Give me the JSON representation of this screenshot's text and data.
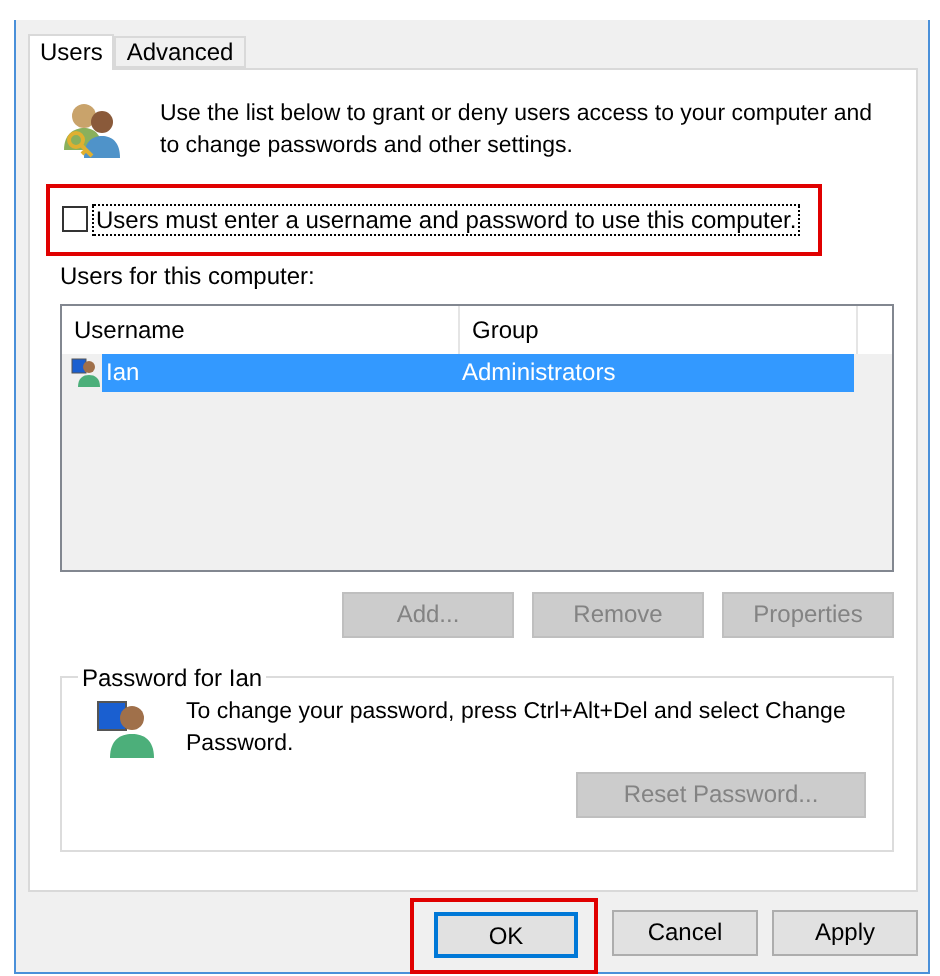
{
  "tabs": [
    {
      "label": "Users",
      "selected": true
    },
    {
      "label": "Advanced",
      "selected": false
    }
  ],
  "intro": "Use the list below to grant or deny users access to your computer and to change passwords and other settings.",
  "require_login": {
    "label": "Users must enter a username and password to use this computer.",
    "checked": false,
    "highlighted": true
  },
  "users_label": "Users for this computer:",
  "table": {
    "columns": [
      "Username",
      "Group"
    ],
    "rows": [
      {
        "username": "Ian",
        "group": "Administrators",
        "selected": true
      }
    ]
  },
  "list_buttons": [
    {
      "label": "Add...",
      "disabled": true
    },
    {
      "label": "Remove",
      "disabled": true
    },
    {
      "label": "Properties",
      "disabled": true
    }
  ],
  "password_group": {
    "title": "Password for Ian",
    "text": "To change your password, press Ctrl+Alt+Del and select Change Password.",
    "button": {
      "label": "Reset Password...",
      "disabled": true
    }
  },
  "dialog_buttons": [
    {
      "label": "OK",
      "default": true,
      "highlighted": true
    },
    {
      "label": "Cancel",
      "default": false,
      "highlighted": false
    },
    {
      "label": "Apply",
      "default": false,
      "highlighted": false
    }
  ]
}
